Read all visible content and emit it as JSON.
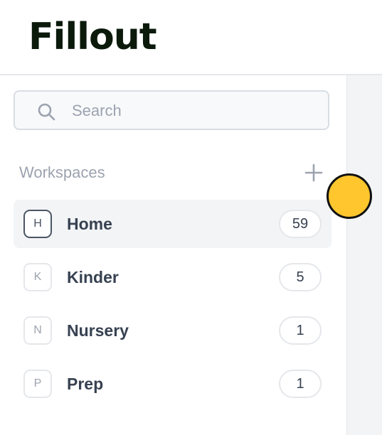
{
  "app": {
    "logo_text": "Fillout"
  },
  "search": {
    "placeholder": "Search",
    "value": "",
    "icon": "search-icon"
  },
  "workspaces": {
    "title": "Workspaces",
    "add_icon": "plus-icon",
    "items": [
      {
        "initial": "H",
        "label": "Home",
        "count": "59",
        "active": true
      },
      {
        "initial": "K",
        "label": "Kinder",
        "count": "5",
        "active": false
      },
      {
        "initial": "N",
        "label": "Nursery",
        "count": "1",
        "active": false
      },
      {
        "initial": "P",
        "label": "Prep",
        "count": "1",
        "active": false
      }
    ]
  },
  "colors": {
    "cursor_dot": "#ffc62e",
    "active_row": "#f3f4f6",
    "logo": "#0b1a0b"
  }
}
